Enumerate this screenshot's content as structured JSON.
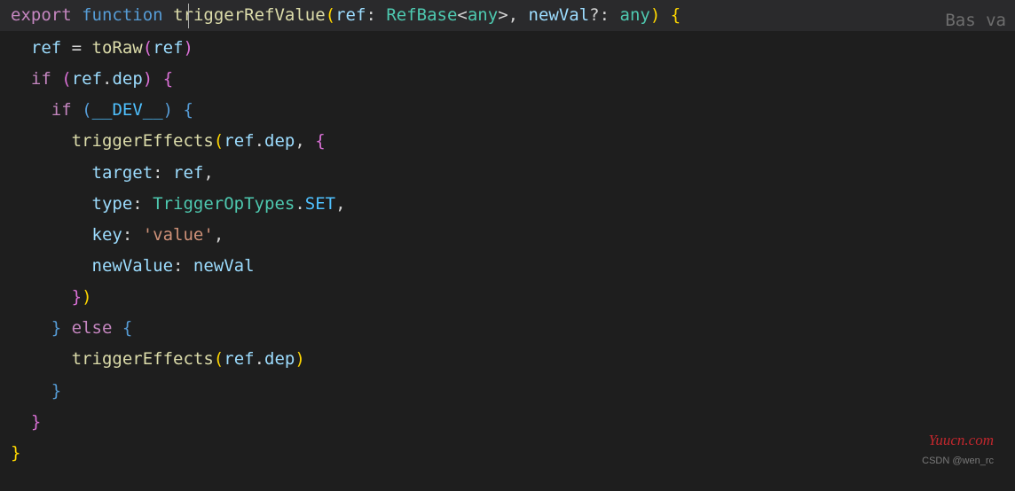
{
  "topline": {
    "export": "export",
    "function": "function",
    "space": " ",
    "fname": "triggerRefValue",
    "open": "(",
    "p1": "ref",
    "colon1": ": ",
    "t1": "RefBase",
    "lt": "<",
    "any1": "any",
    "gt": ">",
    "comma": ", ",
    "p2": "newVal",
    "opt": "?",
    "colon2": ": ",
    "any2": "any",
    "close": ") ",
    "brace": "{",
    "minimap": "Bas va"
  },
  "lines": {
    "l2": {
      "guides": "  ",
      "var1": "ref",
      "eq": " = ",
      "fn": "toRaw",
      "open": "(",
      "arg": "ref",
      "close": ")"
    },
    "l3": {
      "guides": "  ",
      "if": "if",
      "sp": " ",
      "open": "(",
      "var": "ref",
      "dot": ".",
      "prop": "dep",
      "close": ") ",
      "brace": "{"
    },
    "l4": {
      "guides": "    ",
      "if": "if",
      "sp": " ",
      "open": "(",
      "const": "__DEV__",
      "close": ") ",
      "brace": "{"
    },
    "l5": {
      "guides": "      ",
      "fn": "triggerEffects",
      "open": "(",
      "var": "ref",
      "dot": ".",
      "prop": "dep",
      "comma": ", ",
      "brace": "{"
    },
    "l6": {
      "guides": "        ",
      "key": "target",
      "colon": ": ",
      "val": "ref",
      "comma": ","
    },
    "l7": {
      "guides": "        ",
      "key": "type",
      "colon": ": ",
      "cls": "TriggerOpTypes",
      "dot": ".",
      "member": "SET",
      "comma": ","
    },
    "l8": {
      "guides": "        ",
      "key": "key",
      "colon": ": ",
      "str": "'value'",
      "comma": ","
    },
    "l9": {
      "guides": "        ",
      "key": "newValue",
      "colon": ": ",
      "val": "newVal"
    },
    "l10": {
      "guides": "      ",
      "brace": "}",
      "close": ")"
    },
    "l11": {
      "guides": "    ",
      "brace": "}",
      "else": " else ",
      "brace2": "{"
    },
    "l12": {
      "guides": "      ",
      "fn": "triggerEffects",
      "open": "(",
      "var": "ref",
      "dot": ".",
      "prop": "dep",
      "close": ")"
    },
    "l13": {
      "guides": "    ",
      "brace": "}"
    },
    "l14": {
      "guides": "  ",
      "brace": "}"
    },
    "l15": {
      "guides": "",
      "brace": "}"
    }
  },
  "watermark": {
    "main": "Yuucn.com",
    "sub": "CSDN @wen_rc"
  }
}
